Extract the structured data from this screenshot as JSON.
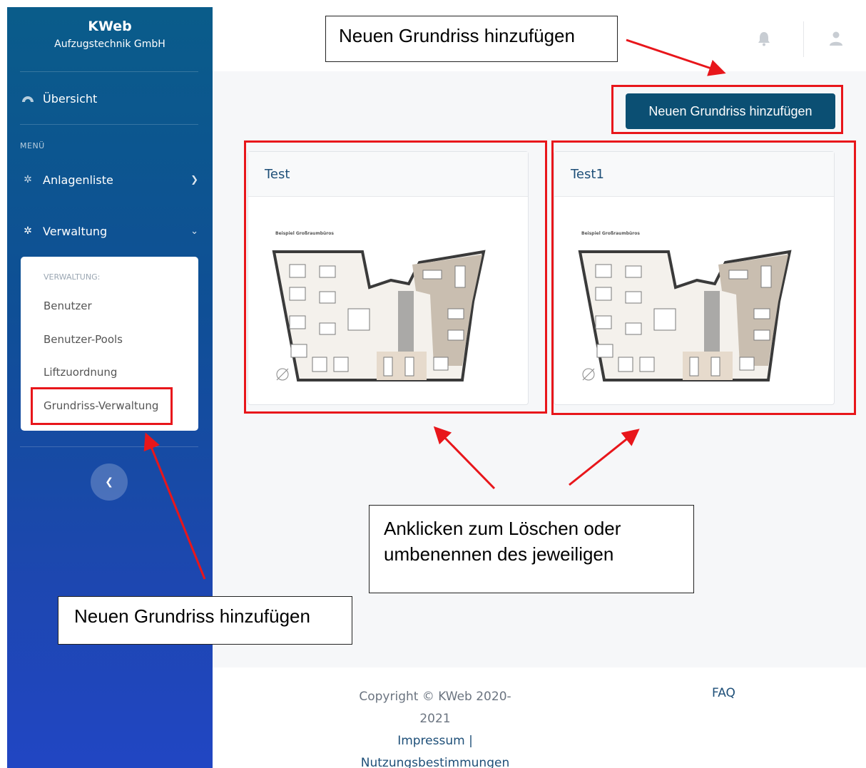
{
  "sidebar": {
    "brand_name": "KWeb",
    "brand_sub": "Aufzugstechnik GmbH",
    "overview": "Übersicht",
    "menu_heading": "MENÜ",
    "anlagenliste": "Anlagenliste",
    "verwaltung": "Verwaltung",
    "submenu": {
      "heading": "VERWALTUNG:",
      "items": [
        "Benutzer",
        "Benutzer-Pools",
        "Liftzuordnung",
        "Grundriss-Verwaltung"
      ]
    }
  },
  "main": {
    "add_button": "Neuen Grundriss hinzufügen",
    "cards": [
      {
        "title": "Test",
        "plan_caption": "Beispiel Großraumbüros"
      },
      {
        "title": "Test1",
        "plan_caption": "Beispiel Großraumbüros"
      }
    ]
  },
  "footer": {
    "copyright_line1": "Copyright © KWeb 2020-",
    "copyright_line2": "2021",
    "impressum": "Impressum |",
    "nutzung": "Nutzungsbestimmungen",
    "faq": "FAQ"
  },
  "annotations": {
    "top": "Neuen Grundriss hinzufügen",
    "middle_line1": "Anklicken zum Löschen oder",
    "middle_line2": "umbenennen des jeweiligen",
    "bottom": "Neuen Grundriss hinzufügen"
  },
  "colors": {
    "sidebar_top": "#0a5c8a",
    "sidebar_bottom": "#2146c3",
    "button": "#0b4f73",
    "annotation_red": "#e8161b"
  }
}
